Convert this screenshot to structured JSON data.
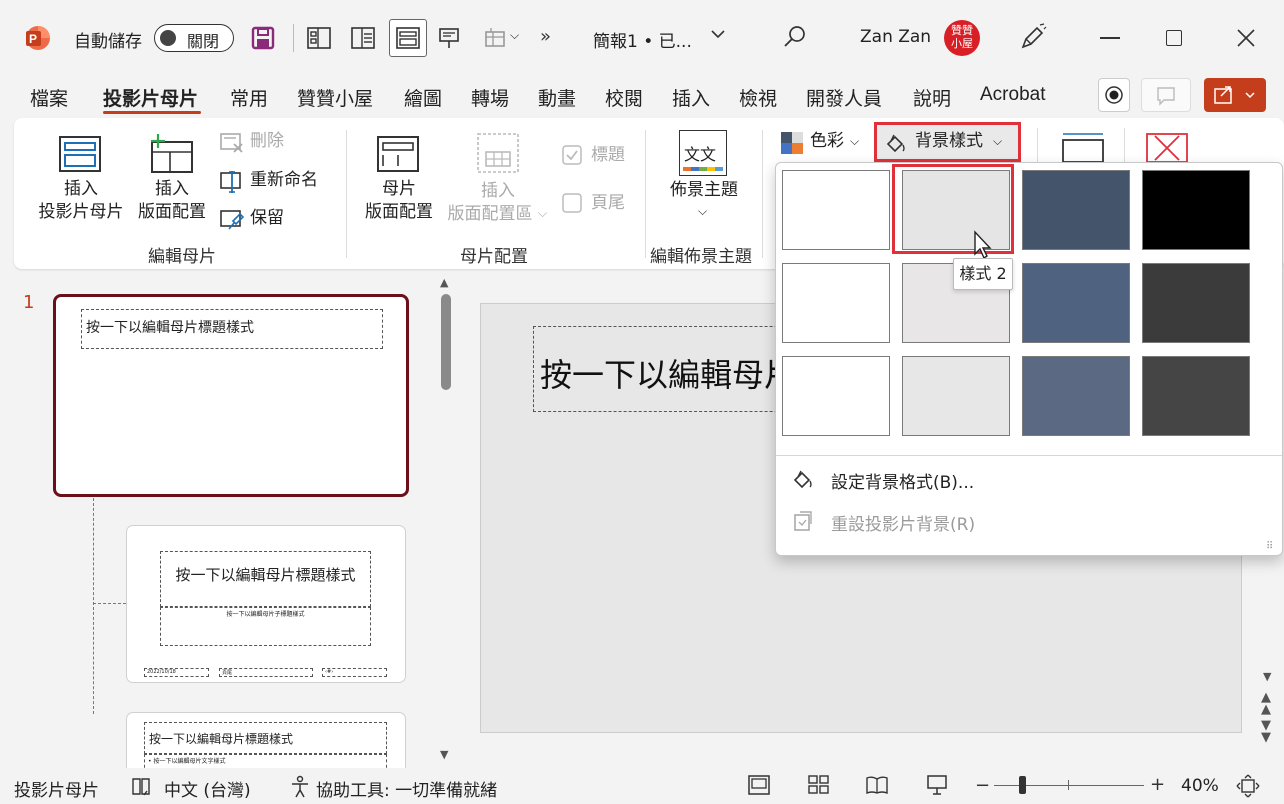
{
  "titlebar": {
    "autosave_label": "自動儲存",
    "autosave_state": "關閉",
    "filename": "簡報1 • 已...",
    "user_name": "Zan Zan",
    "avatar_text": "贊贊小屋"
  },
  "tabs": [
    "檔案",
    "投影片母片",
    "常用",
    "贊贊小屋",
    "繪圖",
    "轉場",
    "動畫",
    "校閱",
    "插入",
    "檢視",
    "開發人員",
    "說明",
    "Acrobat"
  ],
  "ribbon": {
    "insert_master_l1": "插入",
    "insert_master_l2": "投影片母片",
    "insert_layout_l1": "插入",
    "insert_layout_l2": "版面配置",
    "delete": "刪除",
    "rename": "重新命名",
    "preserve": "保留",
    "group_edit_master": "編輯母片",
    "master_layout_l1": "母片",
    "master_layout_l2": "版面配置",
    "insert_placeholder_l1": "插入",
    "insert_placeholder_l2": "版面配置區",
    "title_check": "標題",
    "footer_check": "頁尾",
    "group_master_layout": "母片配置",
    "themes": "佈景主題",
    "themes_icon_text": "文文",
    "group_edit_theme": "編輯佈景主題",
    "colors": "色彩",
    "background_styles": "背景樣式"
  },
  "slides_pane": {
    "slide_number": "1",
    "master_title": "按一下以編輯母片標題樣式",
    "layout1_title": "按一下以編輯母片標題樣式",
    "layout1_subtitle": "按一下以編輯母片子標題樣式",
    "layout1_date": "2022/10/18",
    "layout1_footer": "頁尾",
    "layout1_num": "‹#›",
    "layout2_title": "按一下以編輯母片標題樣式",
    "layout2_body": "• 按一下以編輯母片文字樣式"
  },
  "editor": {
    "title_placeholder": "按一下以編輯母片"
  },
  "dropdown": {
    "swatch_colors": [
      [
        "#ffffff",
        "#e5e5e5",
        "#44546a",
        "#000000"
      ],
      [
        "#ffffff",
        "#e8e6e6",
        "#4f627f",
        "#3b3b3b"
      ],
      [
        "#ffffff",
        "#e7e7e7",
        "#5b6a82",
        "#454545"
      ]
    ],
    "tooltip": "樣式 2",
    "format_background": "設定背景格式(B)...",
    "reset_background": "重設投影片背景(R)"
  },
  "statusbar": {
    "view_name": "投影片母片",
    "language": "中文 (台灣)",
    "accessibility": "協助工具: 一切準備就緒",
    "zoom": "40%"
  },
  "colors": {
    "accent": "#c43e1c",
    "highlight_border": "#e0313b",
    "selected_thumb": "#6b0f1a"
  }
}
